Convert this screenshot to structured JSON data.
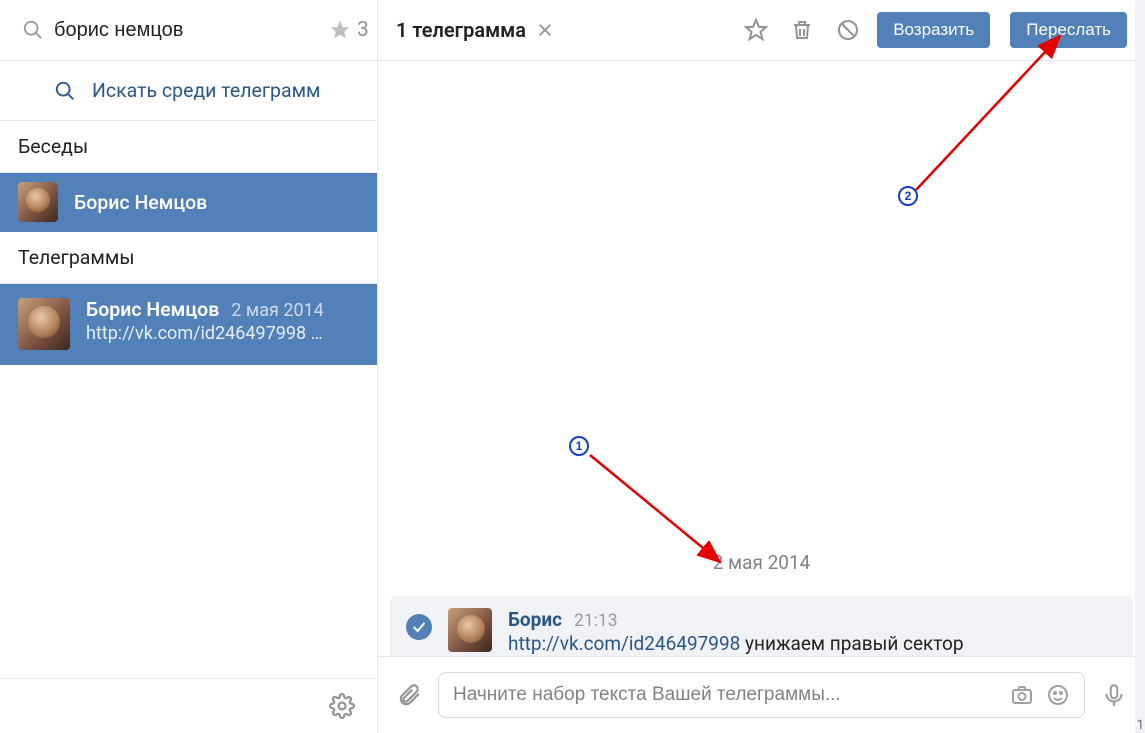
{
  "sidebar": {
    "search_value": "борис немцов",
    "starred_count": "3",
    "search_telegrams_label": "Искать среди телеграмм",
    "section_conversations": "Беседы",
    "contact_name": "Борис Немцов",
    "section_telegrams": "Телеграммы",
    "tele": {
      "name": "Борис Немцов",
      "date": "2 мая 2014",
      "preview": "http://vk.com/id246497998 …"
    }
  },
  "topbar": {
    "title": "1 телеграмма",
    "btn_reply": "Возразить",
    "btn_forward": "Переслать"
  },
  "thread": {
    "date_divider": "2 мая 2014",
    "msg": {
      "sender": "Борис",
      "time": "21:13",
      "link": "http://vk.com/id246497998",
      "text_after_link": " унижаем правый сектор"
    }
  },
  "compose": {
    "placeholder": "Начните набор текста Вашей телеграммы..."
  },
  "annotations": {
    "badge1": "1",
    "badge2": "2"
  },
  "edge_label": "1"
}
